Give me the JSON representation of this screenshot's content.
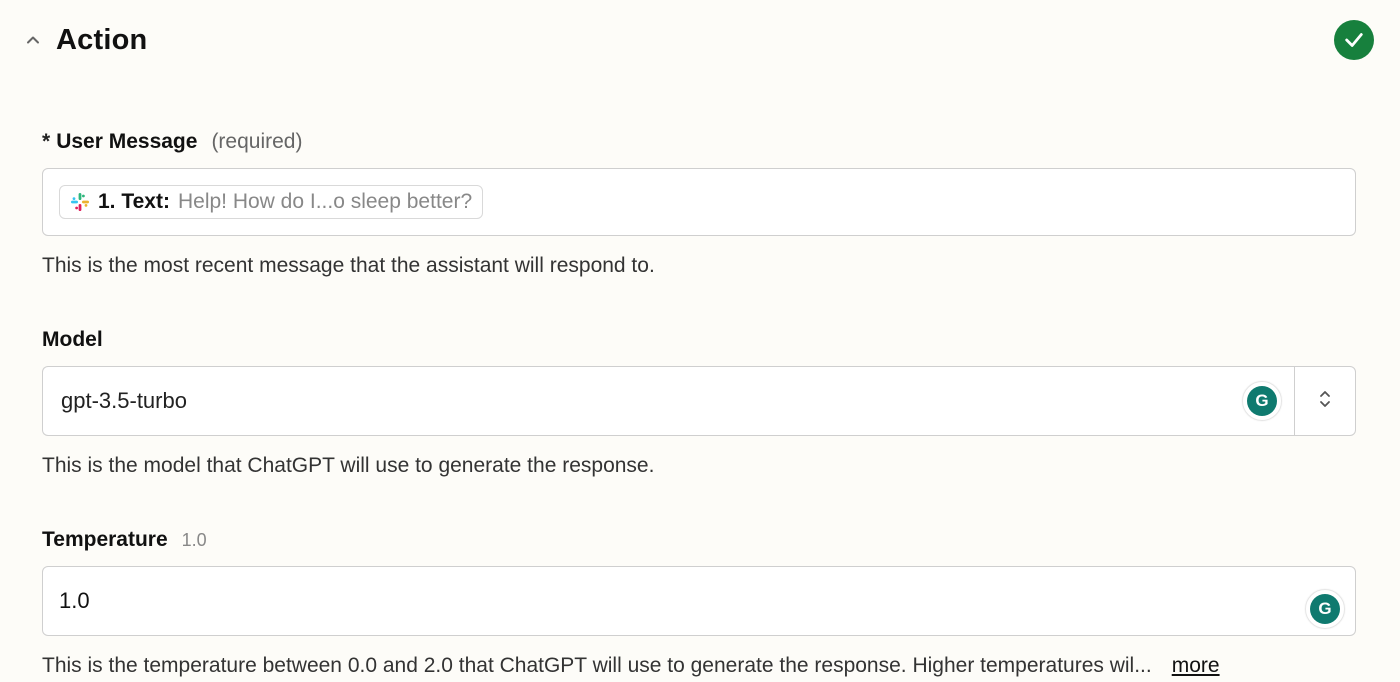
{
  "header": {
    "title": "Action",
    "status_icon": "check"
  },
  "fields": {
    "user_message": {
      "label": "User Message",
      "required_text": "(required)",
      "pill": {
        "app_icon": "slack",
        "prefix": "1. Text:",
        "value": "Help! How do I...o sleep better?"
      },
      "helper": "This is the most recent message that the assistant will respond to."
    },
    "model": {
      "label": "Model",
      "value": "gpt-3.5-turbo",
      "helper": "This is the model that ChatGPT will use to generate the response."
    },
    "temperature": {
      "label": "Temperature",
      "default_hint": "1.0",
      "value": "1.0",
      "helper": "This is the temperature between 0.0 and 2.0 that ChatGPT will use to generate the response. Higher temperatures wil...",
      "more": "more"
    }
  }
}
